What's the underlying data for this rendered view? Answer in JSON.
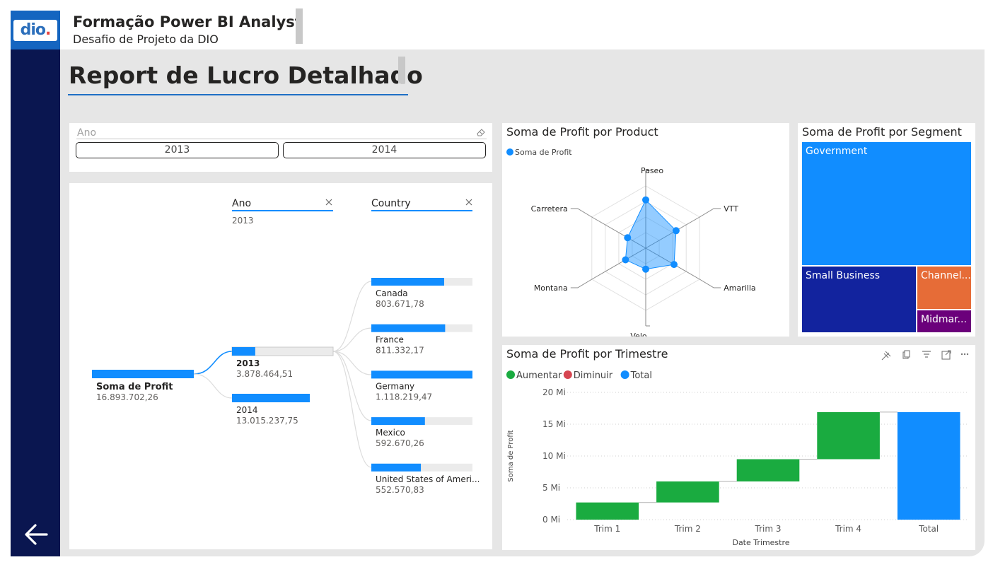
{
  "header": {
    "logo_text": "dio",
    "logo_dot": ".",
    "title": "Formação Power BI Analyst",
    "subtitle": "Desafio de Projeto da DIO"
  },
  "report_title": "Report de Lucro Detalhado",
  "colors": {
    "accent": "#118dff",
    "sidebar": "#0a1650",
    "increase": "#1aab40",
    "decrease": "#d64550",
    "total": "#118dff",
    "navy": "#12239e",
    "orange": "#e66c37",
    "purple": "#6b007b"
  },
  "slicer": {
    "label": "Ano",
    "options": [
      "2013",
      "2014"
    ]
  },
  "decomposition": {
    "root": {
      "label": "Soma de Profit",
      "value": "16.893.702,26"
    },
    "ano_header": "Ano",
    "ano_selected": "2013",
    "country_header": "Country",
    "years": [
      {
        "label": "2013",
        "value": "3.878.464,51",
        "fraction": 0.23
      },
      {
        "label": "2014",
        "value": "13.015.237,75",
        "fraction": 0.77
      }
    ],
    "countries": [
      {
        "label": "Canada",
        "value": "803.671,78",
        "fraction": 0.72
      },
      {
        "label": "France",
        "value": "811.332,17",
        "fraction": 0.73
      },
      {
        "label": "Germany",
        "value": "1.118.219,47",
        "fraction": 1.0
      },
      {
        "label": "Mexico",
        "value": "592.670,26",
        "fraction": 0.53
      },
      {
        "label": "United States of Ameri...",
        "value": "552.570,83",
        "fraction": 0.49
      }
    ]
  },
  "radar": {
    "title": "Soma de Profit por Product",
    "legend": "Soma de Profit",
    "axes": [
      "Paseo",
      "VTT",
      "Amarilla",
      "Velo",
      "Montana",
      "Carretera"
    ],
    "values": [
      0.62,
      0.45,
      0.42,
      0.27,
      0.3,
      0.27
    ]
  },
  "treemap": {
    "title": "Soma de Profit por Segment",
    "tiles": [
      {
        "label": "Government",
        "color": "#118dff"
      },
      {
        "label": "Small Business",
        "color": "#12239e"
      },
      {
        "label": "Channel...",
        "color": "#e66c37"
      },
      {
        "label": "Midmar...",
        "color": "#6b007b"
      }
    ]
  },
  "waterfall": {
    "title": "Soma de Profit por Trimestre",
    "legend": [
      {
        "label": "Aumentar",
        "color": "#1aab40"
      },
      {
        "label": "Diminuir",
        "color": "#d64550"
      },
      {
        "label": "Total",
        "color": "#118dff"
      }
    ],
    "toolbar": [
      "pin-icon",
      "copy-icon",
      "filter-icon",
      "focus-mode-icon",
      "more-options-icon"
    ]
  },
  "chart_data": {
    "type": "bar",
    "subtype": "waterfall",
    "title": "Soma de Profit por Trimestre",
    "xlabel": "Date Trimestre",
    "ylabel": "Soma de Profit",
    "categories": [
      "Trim 1",
      "Trim 2",
      "Trim 3",
      "Trim 4",
      "Total"
    ],
    "values": [
      2.7,
      3.3,
      3.5,
      7.4,
      16.9
    ],
    "ylim": [
      0,
      20
    ],
    "yticks": [
      0,
      5,
      10,
      15,
      20
    ],
    "ytick_labels": [
      "0 Mi",
      "5 Mi",
      "10 Mi",
      "15 Mi",
      "20 Mi"
    ],
    "grid": true,
    "legend_position": "top-left"
  }
}
